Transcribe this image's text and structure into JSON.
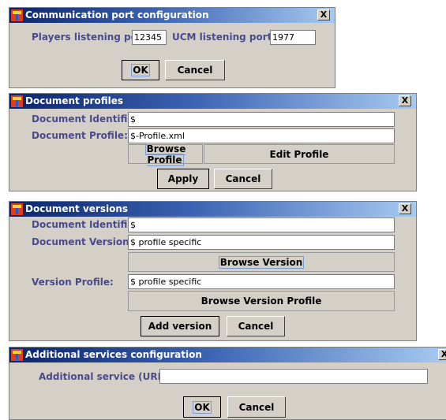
{
  "comm_dialog": {
    "title": "Communication port configuration",
    "close": "X",
    "players_label": "Players listening port",
    "players_value": "12345",
    "ucm_label": "UCM listening port",
    "ucm_value": "1977",
    "ok": "OK",
    "cancel": "Cancel"
  },
  "profiles_dialog": {
    "title": "Document profiles",
    "close": "X",
    "doc_id_label": "Document Identifier:",
    "doc_id_value": "$",
    "doc_profile_label": "Document Profile:",
    "doc_profile_value": "$-Profile.xml",
    "browse_profile": "Browse Profile",
    "edit_profile": "Edit Profile",
    "apply": "Apply",
    "cancel": "Cancel"
  },
  "versions_dialog": {
    "title": "Document versions",
    "close": "X",
    "doc_id_label": "Document Identifier:",
    "doc_id_value": "$",
    "doc_version_label": "Document Version:",
    "doc_version_value": "$ profile specific",
    "browse_version": "Browse Version",
    "version_profile_label": "Version Profile:",
    "version_profile_value": "$ profile specific",
    "browse_version_profile": "Browse Version Profile",
    "add_version": "Add version",
    "cancel": "Cancel"
  },
  "services_dialog": {
    "title": "Additional services configuration",
    "close": "X",
    "url_label": "Additional service (URL):",
    "url_value": "",
    "ok": "OK",
    "cancel": "Cancel"
  }
}
